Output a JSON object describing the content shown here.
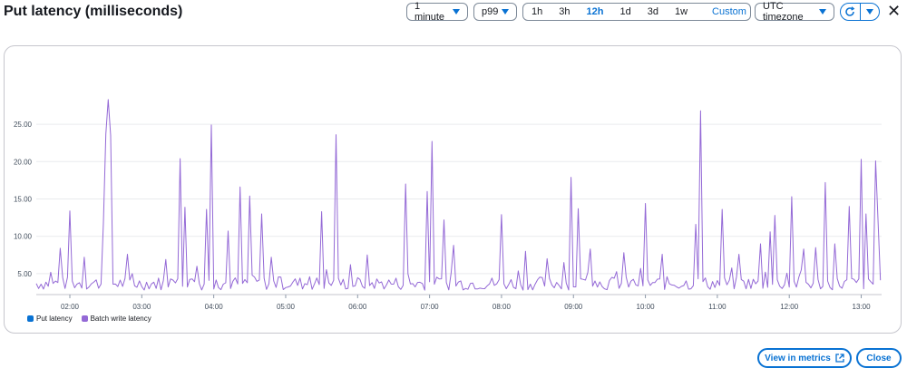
{
  "header": {
    "title": "Put latency (milliseconds)"
  },
  "controls": {
    "period": "1 minute",
    "statistic": "p99",
    "ranges": [
      "1h",
      "3h",
      "12h",
      "1d",
      "3d",
      "1w"
    ],
    "active_range": "12h",
    "custom_label": "Custom",
    "timezone": "UTC timezone"
  },
  "footer": {
    "view_metrics_label": "View in metrics",
    "close_label": "Close"
  },
  "colors": {
    "put_latency": "#0972d3",
    "batch_write_latency": "#9469d6",
    "accent": "#0972d3",
    "grid": "#e9ebed"
  },
  "icons": [
    "caret-down-icon",
    "calendar-icon",
    "refresh-icon",
    "close-icon",
    "external-link-icon"
  ],
  "chart_data": {
    "type": "line",
    "title": "",
    "xlabel": "",
    "ylabel": "",
    "x_start": "01:32",
    "x_end": "13:17",
    "x_ticks": [
      "02:00",
      "03:00",
      "04:00",
      "05:00",
      "06:00",
      "07:00",
      "08:00",
      "09:00",
      "10:00",
      "11:00",
      "12:00",
      "13:00"
    ],
    "y_ticks": [
      "5.00",
      "10.00",
      "15.00",
      "20.00",
      "25.00"
    ],
    "ylim": [
      2.2,
      29.5
    ],
    "grid": true,
    "legend_position": "bottom-left",
    "series": [
      {
        "name": "Put latency",
        "values": []
      },
      {
        "name": "Batch write latency",
        "baseline": [
          2.8,
          4.6
        ],
        "peaks": [
          [
            "01:52",
            8.4
          ],
          [
            "02:00",
            13.4
          ],
          [
            "02:12",
            7.2
          ],
          [
            "02:28",
            11.8
          ],
          [
            "02:31",
            23.7
          ],
          [
            "02:33",
            28.3
          ],
          [
            "02:35",
            23.5
          ],
          [
            "02:48",
            7.6
          ],
          [
            "03:20",
            6.9
          ],
          [
            "03:33",
            20.4
          ],
          [
            "03:36",
            13.9
          ],
          [
            "03:46",
            6.0
          ],
          [
            "03:55",
            13.6
          ],
          [
            "03:59",
            24.9
          ],
          [
            "04:13",
            10.7
          ],
          [
            "04:23",
            16.6
          ],
          [
            "04:30",
            15.4
          ],
          [
            "04:40",
            13.0
          ],
          [
            "04:48",
            7.2
          ],
          [
            "05:30",
            13.3
          ],
          [
            "05:42",
            23.6
          ],
          [
            "05:55",
            6.2
          ],
          [
            "06:08",
            7.5
          ],
          [
            "06:40",
            17.0
          ],
          [
            "06:58",
            16.0
          ],
          [
            "07:02",
            22.7
          ],
          [
            "07:12",
            12.2
          ],
          [
            "07:20",
            8.8
          ],
          [
            "08:00",
            12.9
          ],
          [
            "08:20",
            8.0
          ],
          [
            "08:38",
            7.0
          ],
          [
            "08:52",
            6.5
          ],
          [
            "08:59",
            17.9
          ],
          [
            "09:05",
            13.7
          ],
          [
            "09:15",
            8.3
          ],
          [
            "09:43",
            7.8
          ],
          [
            "10:00",
            14.4
          ],
          [
            "10:15",
            7.6
          ],
          [
            "10:43",
            11.6
          ],
          [
            "10:47",
            26.8
          ],
          [
            "11:05",
            13.6
          ],
          [
            "11:18",
            7.6
          ],
          [
            "11:37",
            9.0
          ],
          [
            "11:44",
            10.6
          ],
          [
            "11:48",
            12.8
          ],
          [
            "12:02",
            15.3
          ],
          [
            "12:12",
            8.3
          ],
          [
            "12:23",
            8.5
          ],
          [
            "12:31",
            17.2
          ],
          [
            "12:38",
            9.0
          ],
          [
            "12:50",
            14.0
          ],
          [
            "13:00",
            20.3
          ],
          [
            "13:05",
            13.0
          ],
          [
            "13:13",
            20.1
          ],
          [
            "13:15",
            12.3
          ]
        ]
      }
    ]
  }
}
